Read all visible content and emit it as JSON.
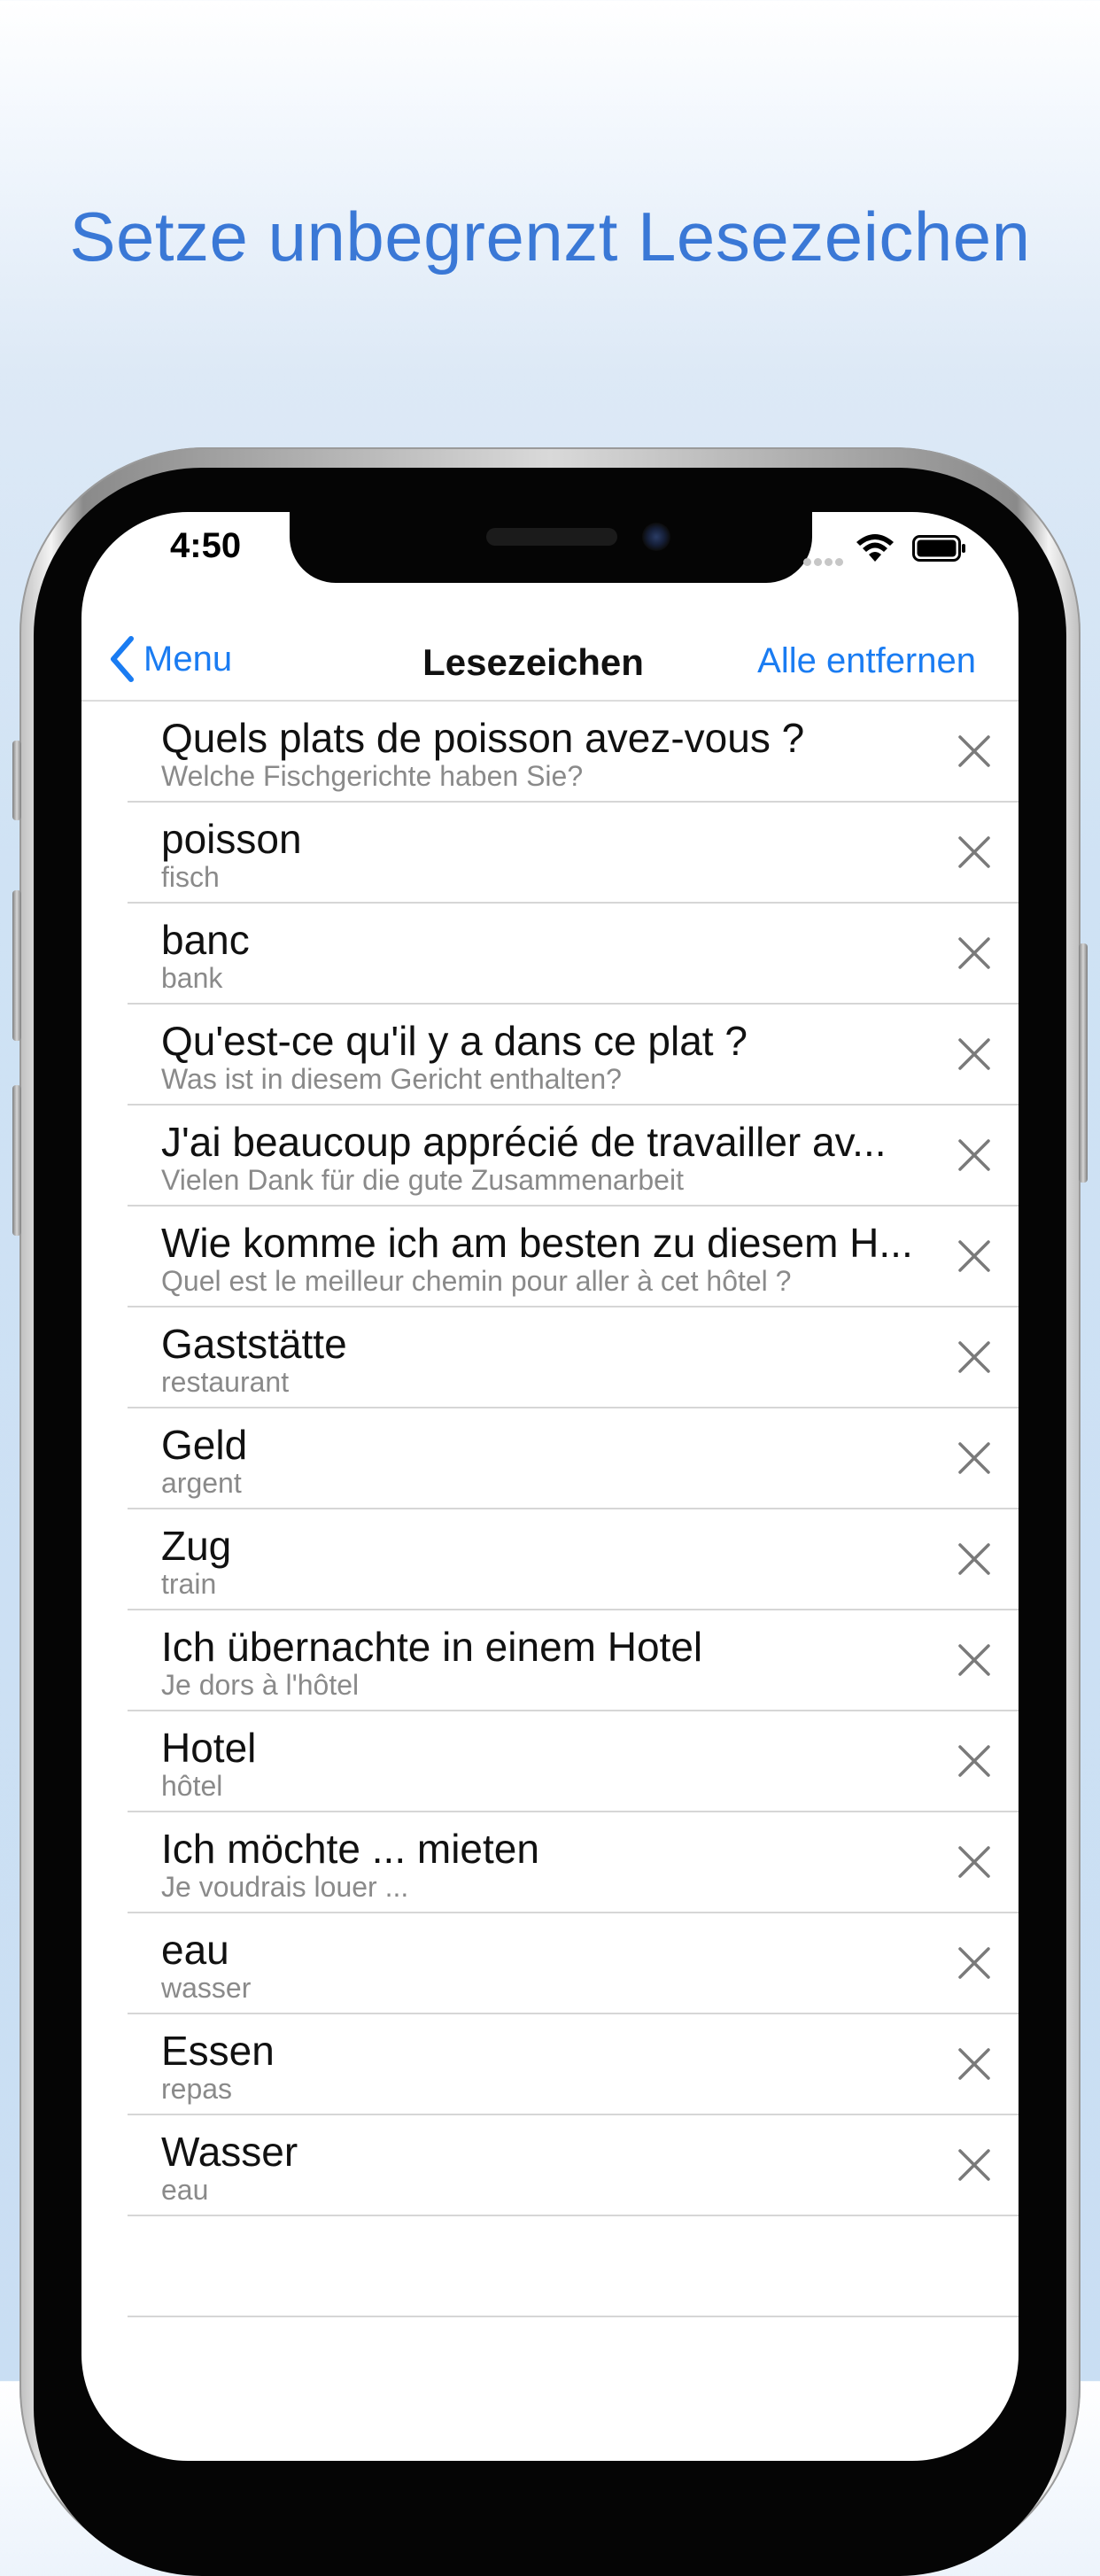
{
  "headline": "Setze unbegrenzt Lesezeichen",
  "status_bar": {
    "time": "4:50"
  },
  "nav": {
    "back_label": "Menu",
    "title": "Lesezeichen",
    "action_label": "Alle entfernen"
  },
  "colors": {
    "accent": "#1a7cf2",
    "headline": "#3a78d6"
  },
  "icons": {
    "back": "chevron-left-icon",
    "remove": "close-icon",
    "wifi": "wifi-icon",
    "battery": "battery-icon"
  },
  "bookmarks": [
    {
      "main": "Quels plats de poisson avez-vous ?",
      "sub": "Welche Fischgerichte haben Sie?"
    },
    {
      "main": "poisson",
      "sub": "fisch"
    },
    {
      "main": "banc",
      "sub": "bank"
    },
    {
      "main": "Qu'est-ce qu'il y a dans ce plat ?",
      "sub": "Was ist in diesem Gericht enthalten?"
    },
    {
      "main": "J'ai beaucoup apprécié de travailler av...",
      "sub": "Vielen Dank für die gute Zusammenarbeit"
    },
    {
      "main": "Wie komme ich am besten zu diesem H...",
      "sub": "Quel est le meilleur chemin pour aller à cet hôtel ?"
    },
    {
      "main": "Gaststätte",
      "sub": "restaurant"
    },
    {
      "main": "Geld",
      "sub": "argent"
    },
    {
      "main": "Zug",
      "sub": "train"
    },
    {
      "main": "Ich übernachte in einem Hotel",
      "sub": "Je dors à l'hôtel"
    },
    {
      "main": "Hotel",
      "sub": "hôtel"
    },
    {
      "main": "Ich möchte ... mieten",
      "sub": "Je voudrais louer ..."
    },
    {
      "main": "eau",
      "sub": "wasser"
    },
    {
      "main": "Essen",
      "sub": "repas"
    },
    {
      "main": "Wasser",
      "sub": "eau"
    }
  ]
}
